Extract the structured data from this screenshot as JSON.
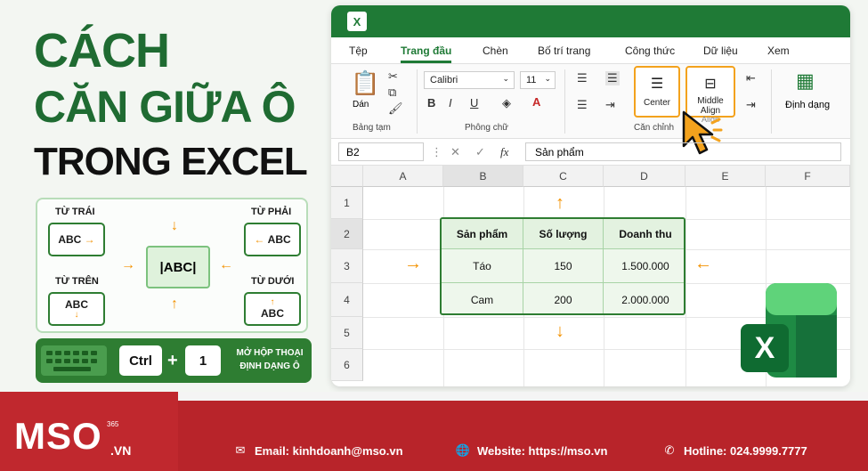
{
  "headline": {
    "line1": "CÁCH",
    "line2": "CĂN GIỮA Ô",
    "line3": "TRONG EXCEL"
  },
  "align_demo": {
    "left_label": "TỪ TRÁI",
    "right_label": "TỪ PHẢI",
    "top_label": "TỪ TRÊN",
    "bottom_label": "TỪ DƯỚI",
    "sample": "ABC",
    "center_sample": "|ABC|"
  },
  "shortcut": {
    "key1": "Ctrl",
    "plus": "+",
    "key2": "1",
    "description": "MỞ HỘP THOẠI ĐỊNH DẠNG Ô"
  },
  "excel": {
    "app_icon": "X",
    "tabs": [
      "Tệp",
      "Trang đầu",
      "Chèn",
      "Bố trí trang",
      "Công thức",
      "Dữ liệu",
      "Xem"
    ],
    "active_tab": "Trang đầu",
    "ribbon": {
      "paste_label": "Dán",
      "clipboard_group": "Bảng tạm",
      "font_name": "Calibri",
      "font_size": "11",
      "bold": "B",
      "italic": "I",
      "underline": "U",
      "font_group": "Phông chữ",
      "center_button": "Center",
      "middle_align_button": "Middle Align",
      "middle_align_sub": "Align",
      "alignment_group": "Căn chỉnh",
      "format_button": "Định dạng"
    },
    "formula_bar": {
      "name_box": "B2",
      "fx": "fx",
      "value": "Sản phẩm"
    },
    "columns": [
      "A",
      "B",
      "C",
      "D",
      "E",
      "F"
    ],
    "rows": [
      "1",
      "2",
      "3",
      "4",
      "5",
      "6"
    ],
    "table": {
      "headers": [
        "Sản phẩm",
        "Số lượng",
        "Doanh thu"
      ],
      "rows": [
        [
          "Táo",
          "150",
          "1.500.000"
        ],
        [
          "Cam",
          "200",
          "2.000.000"
        ]
      ]
    },
    "big_logo": "X"
  },
  "footer": {
    "brand": "MSO",
    "brand_sup": "365",
    "brand_tld": ".VN",
    "email": "Email: kinhdoanh@mso.vn",
    "website": "Website: https://mso.vn",
    "hotline": "Hotline: 024.9999.7777"
  },
  "colors": {
    "excel_green": "#1f7a36",
    "accent_orange": "#f39200",
    "footer_red": "#b8242a"
  }
}
